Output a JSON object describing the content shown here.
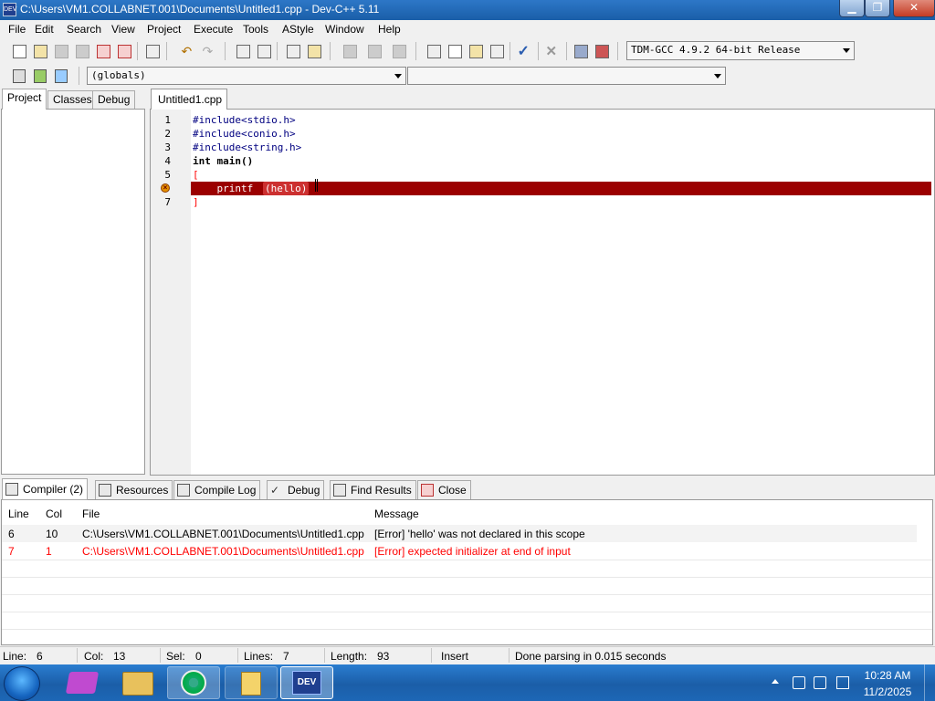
{
  "window": {
    "title": "C:\\Users\\VM1.COLLABNET.001\\Documents\\Untitled1.cpp - Dev-C++ 5.11",
    "app_icon_text": "DEV"
  },
  "menu": [
    "File",
    "Edit",
    "Search",
    "View",
    "Project",
    "Execute",
    "Tools",
    "AStyle",
    "Window",
    "Help"
  ],
  "toolbar": {
    "compiler_select": "TDM-GCC 4.9.2 64-bit Release"
  },
  "scope_combo": {
    "value": "(globals)",
    "second_value": ""
  },
  "left_tabs": [
    "Project",
    "Classes",
    "Debug"
  ],
  "editor": {
    "tab": "Untitled1.cpp",
    "line_numbers": [
      "1",
      "2",
      "3",
      "4",
      "5",
      "7"
    ],
    "lines": [
      "#include<stdio.h>",
      "#include<conio.h>",
      "#include<string.h>",
      "int main()",
      "[",
      "    printf ",
      "(hello)",
      "]"
    ]
  },
  "bottom_tabs": [
    "Compiler (2)",
    "Resources",
    "Compile Log",
    "Debug",
    "Find Results",
    "Close"
  ],
  "compiler": {
    "headers": [
      "Line",
      "Col",
      "File",
      "Message"
    ],
    "rows": [
      {
        "line": "6",
        "col": "10",
        "file": "C:\\Users\\VM1.COLLABNET.001\\Documents\\Untitled1.cpp",
        "message": "[Error] 'hello' was not declared in this scope"
      },
      {
        "line": "7",
        "col": "1",
        "file": "C:\\Users\\VM1.COLLABNET.001\\Documents\\Untitled1.cpp",
        "message": "[Error] expected initializer at end of input"
      }
    ]
  },
  "status": {
    "line_label": "Line:",
    "line": "6",
    "col_label": "Col:",
    "col": "13",
    "sel_label": "Sel:",
    "sel": "0",
    "lines_label": "Lines:",
    "lines": "7",
    "length_label": "Length:",
    "length": "93",
    "mode": "Insert",
    "message": "Done parsing in 0.015 seconds"
  },
  "taskbar": {
    "dev_label": "DEV",
    "time": "10:28 AM",
    "date": "11/2/2025"
  },
  "colors": {
    "error_line": "#9b0000",
    "error_text": "#ff0000",
    "titlebar": "#1a5ea8"
  }
}
